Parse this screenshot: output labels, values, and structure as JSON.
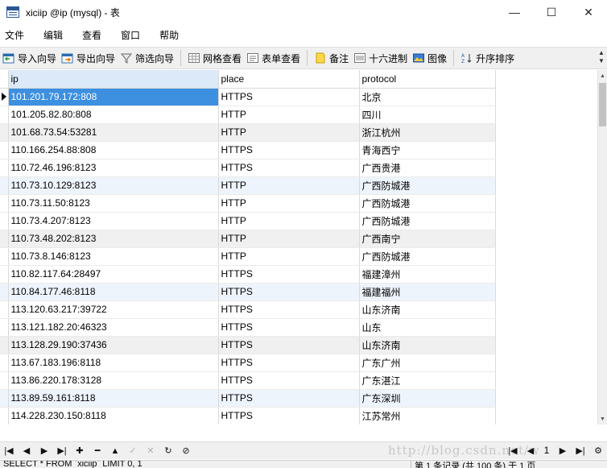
{
  "window": {
    "title": "xiciip @ip (mysql) - 表",
    "minimize": "—",
    "maximize": "☐",
    "close": "✕"
  },
  "menu": [
    "文件",
    "编辑",
    "查看",
    "窗口",
    "帮助"
  ],
  "toolbar": {
    "import_wizard": "导入向导",
    "export_wizard": "导出向导",
    "filter_wizard": "筛选向导",
    "grid_view": "网格查看",
    "form_view": "表单查看",
    "memo": "备注",
    "hex": "十六进制",
    "image": "图像",
    "sort_asc": "升序排序"
  },
  "table": {
    "columns": [
      "ip",
      "place",
      "protocol"
    ],
    "rows": [
      [
        "101.201.79.172:808",
        "HTTPS",
        "北京"
      ],
      [
        "101.205.82.80:808",
        "HTTP",
        "四川"
      ],
      [
        "101.68.73.54:53281",
        "HTTP",
        "浙江杭州"
      ],
      [
        "110.166.254.88:808",
        "HTTPS",
        "青海西宁"
      ],
      [
        "110.72.46.196:8123",
        "HTTPS",
        "广西贵港"
      ],
      [
        "110.73.10.129:8123",
        "HTTP",
        "广西防城港"
      ],
      [
        "110.73.11.50:8123",
        "HTTP",
        "广西防城港"
      ],
      [
        "110.73.4.207:8123",
        "HTTP",
        "广西防城港"
      ],
      [
        "110.73.48.202:8123",
        "HTTP",
        "广西南宁"
      ],
      [
        "110.73.8.146:8123",
        "HTTP",
        "广西防城港"
      ],
      [
        "110.82.117.64:28497",
        "HTTPS",
        "福建漳州"
      ],
      [
        "110.84.177.46:8118",
        "HTTPS",
        "福建福州"
      ],
      [
        "113.120.63.217:39722",
        "HTTPS",
        "山东济南"
      ],
      [
        "113.121.182.20:46323",
        "HTTPS",
        "山东"
      ],
      [
        "113.128.29.190:37436",
        "HTTPS",
        "山东济南"
      ],
      [
        "113.67.183.196:8118",
        "HTTPS",
        "广东广州"
      ],
      [
        "113.86.220.178:3128",
        "HTTPS",
        "广东湛江"
      ],
      [
        "113.89.59.161:8118",
        "HTTPS",
        "广东深圳"
      ],
      [
        "114.228.230.150:8118",
        "HTTPS",
        "江苏常州"
      ]
    ]
  },
  "pager": {
    "page": "1"
  },
  "watermark": "http://blog.csdn.net/w",
  "status": {
    "sql": "SELECT * FROM `xiciip` LIMIT 0, 1",
    "count": "第 1 条记录 (共 100 条) 于 1 页"
  }
}
